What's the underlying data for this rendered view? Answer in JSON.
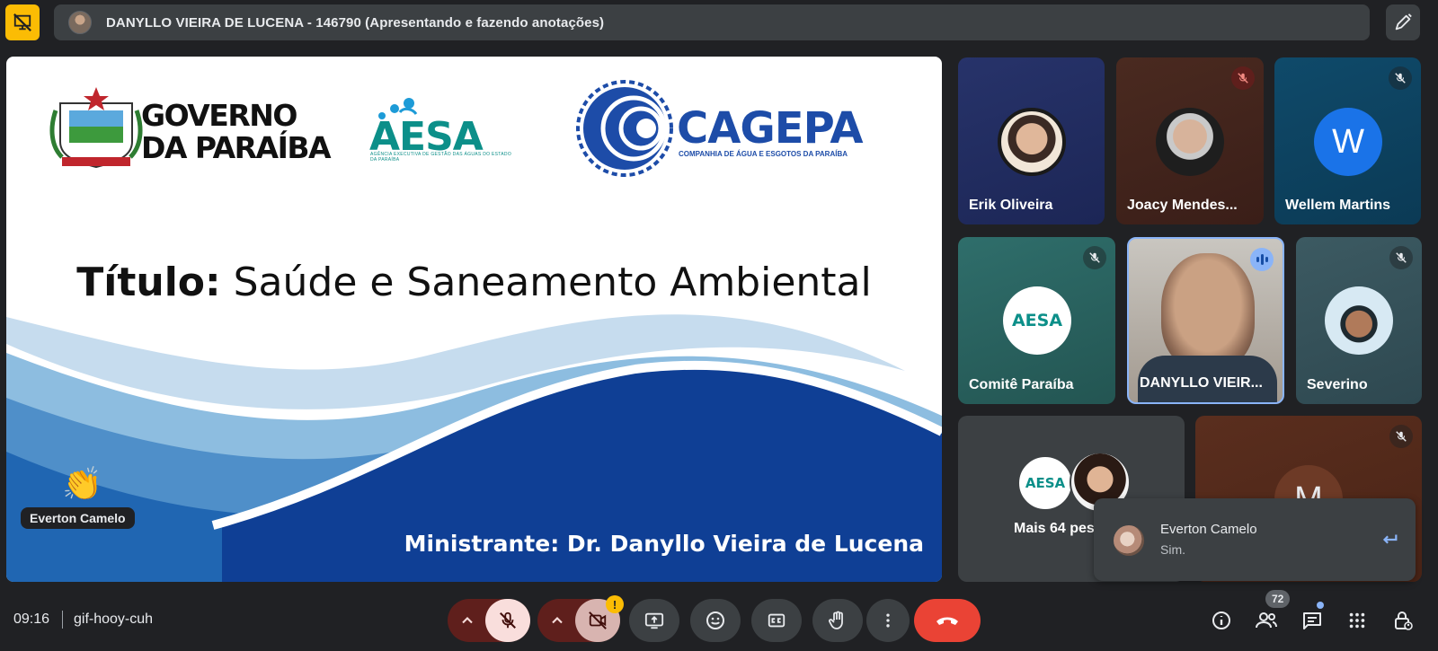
{
  "presenter_bar": {
    "text": "DANYLLO VIEIRA DE LUCENA - 146790 (Apresentando e fazendo anotações)",
    "left_icon": "presentation-off-icon",
    "right_icon": "annotate-pen-icon"
  },
  "slide": {
    "logos": {
      "governo": "GOVERNO\nDA PARAÍBA",
      "aesa": "AESA",
      "aesa_sub": "AGÊNCIA EXECUTIVA DE GESTÃO DAS ÁGUAS DO ESTADO DA PARAÍBA",
      "cagepa": "CAGEPA",
      "cagepa_sub": "COMPANHIA DE ÁGUA E ESGOTOS DA PARAÍBA"
    },
    "title_label": "Título:",
    "title_text": " Saúde e Saneamento Ambiental",
    "minister": "Ministrante: Dr. Danyllo Vieira de Lucena",
    "reaction_emoji": "👏",
    "reaction_name": "Everton Camelo"
  },
  "participants": [
    {
      "name": "Erik Oliveira",
      "muted": false
    },
    {
      "name": "Joacy Mendes...",
      "muted": true
    },
    {
      "name": "Wellem Martins",
      "initial": "W",
      "muted": true
    },
    {
      "name": "Comitê Paraíba",
      "muted": true
    },
    {
      "name": "DANYLLO VIEIR...",
      "speaking": true
    },
    {
      "name": "Severino",
      "muted": true
    },
    {
      "name": "Mais 64 pes"
    },
    {
      "name": "",
      "initial": "M",
      "muted": true
    }
  ],
  "toast": {
    "name": "Everton Camelo",
    "message": "Sim.",
    "reply_icon": "reply-arrow-icon"
  },
  "bottom_bar": {
    "time": "09:16",
    "meeting_code": "gif-hooy-cuh",
    "camera_warning": "!",
    "participant_count": "72",
    "colors": {
      "hangup": "#ea4335",
      "mic_off_bg": "#f9dedc",
      "accent": "#8ab4f8"
    }
  }
}
